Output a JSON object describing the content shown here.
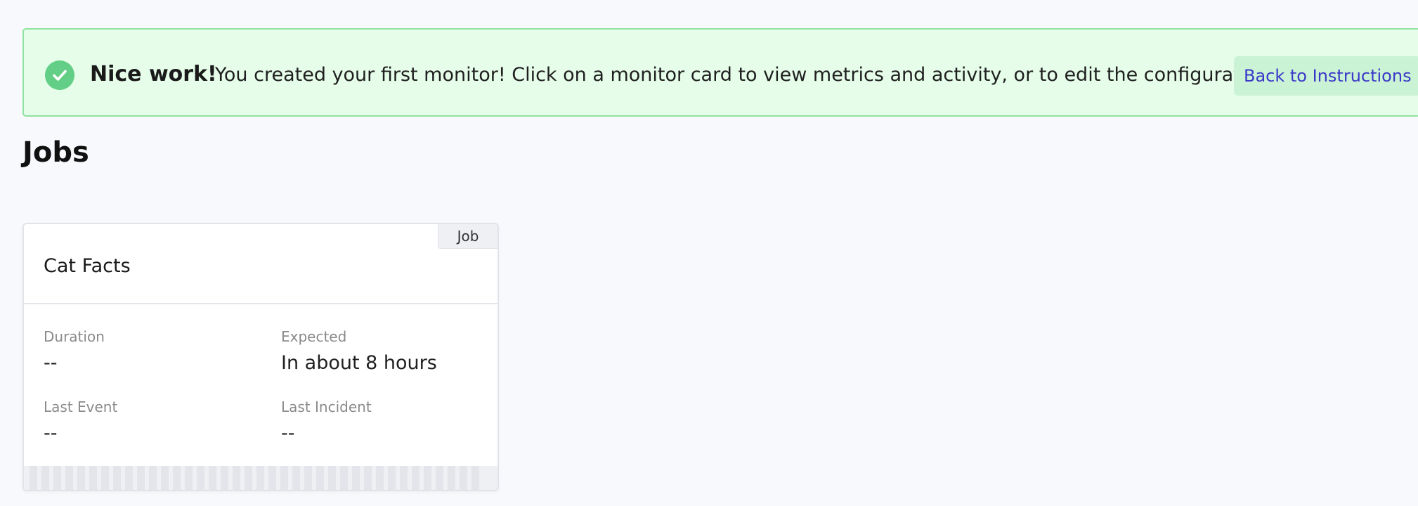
{
  "banner": {
    "icon": "check-circle-icon",
    "title": "Nice work!",
    "message": "You created your first monitor! Click on a monitor card to view metrics and activity, or to edit the configuration.",
    "button_label": "Back to Instructions"
  },
  "page": {
    "title": "Jobs"
  },
  "monitor_card": {
    "tag": "Job",
    "name": "Cat Facts",
    "stats": {
      "duration_label": "Duration",
      "duration_value": "--",
      "expected_label": "Expected",
      "expected_value": "In about 8 hours",
      "last_event_label": "Last Event",
      "last_event_value": "--",
      "last_incident_label": "Last Incident",
      "last_incident_value": "--"
    }
  },
  "colors": {
    "banner_bg": "#e5fde9",
    "banner_border": "#8fe3a0",
    "check_green": "#63cf86",
    "link_blue": "#3b38c8"
  }
}
